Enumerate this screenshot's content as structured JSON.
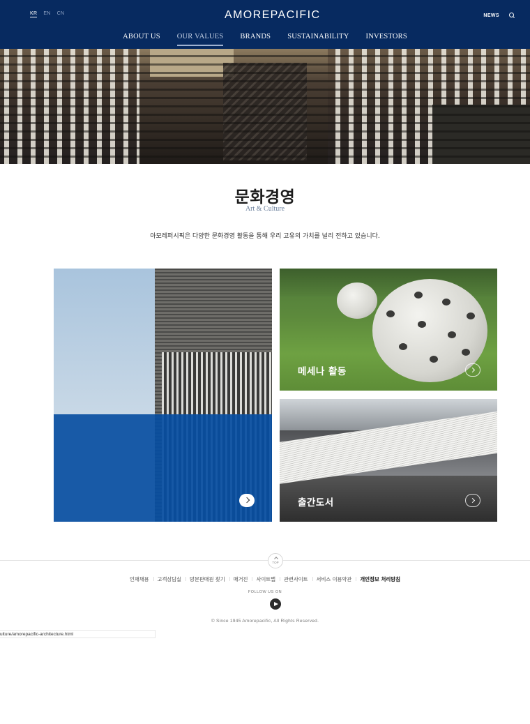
{
  "header": {
    "languages": [
      {
        "label": "KR",
        "active": true
      },
      {
        "label": "EN",
        "active": false
      },
      {
        "label": "CN",
        "active": false
      }
    ],
    "logo": "AMOREPACIFIC",
    "news_label": "NEWS",
    "search_icon": "search-icon",
    "nav": [
      {
        "label": "ABOUT US",
        "active": false
      },
      {
        "label": "OUR VALUES",
        "active": true
      },
      {
        "label": "BRANDS",
        "active": false
      },
      {
        "label": "SUSTAINABILITY",
        "active": false
      },
      {
        "label": "INVESTORS",
        "active": false
      }
    ],
    "brand_color": "#072a60"
  },
  "intro": {
    "title_ko": "문화경영",
    "title_en": "Art & Culture",
    "description": "아모레퍼시픽은 다양한 문화경영 활동을 통해 우리 고유의 가치를 널리 전하고 있습니다."
  },
  "cards": [
    {
      "label": "",
      "icon": "chevron-right-icon",
      "overlay_color": "#064ea0"
    },
    {
      "label": "메세나 활동",
      "icon": "chevron-right-icon"
    },
    {
      "label": "출간도서",
      "icon": "chevron-right-icon"
    }
  ],
  "footer": {
    "top_label": "TOP",
    "links": [
      {
        "label": "인재채용",
        "strong": false
      },
      {
        "label": "고객상담실",
        "strong": false
      },
      {
        "label": "방문판매원 찾기",
        "strong": false
      },
      {
        "label": "매거진",
        "strong": false
      },
      {
        "label": "사이트맵",
        "strong": false
      },
      {
        "label": "관련사이트",
        "strong": false
      },
      {
        "label": "서비스 이용약관",
        "strong": false
      },
      {
        "label": "개인정보 처리방침",
        "strong": true
      }
    ],
    "follow_label": "FOLLOW US ON",
    "social_icon": "youtube-icon",
    "copyright": "© Since 1945 Amorepacific, All Rights Reserved."
  },
  "status_url": "ulture/amorepacific-architecture.html"
}
